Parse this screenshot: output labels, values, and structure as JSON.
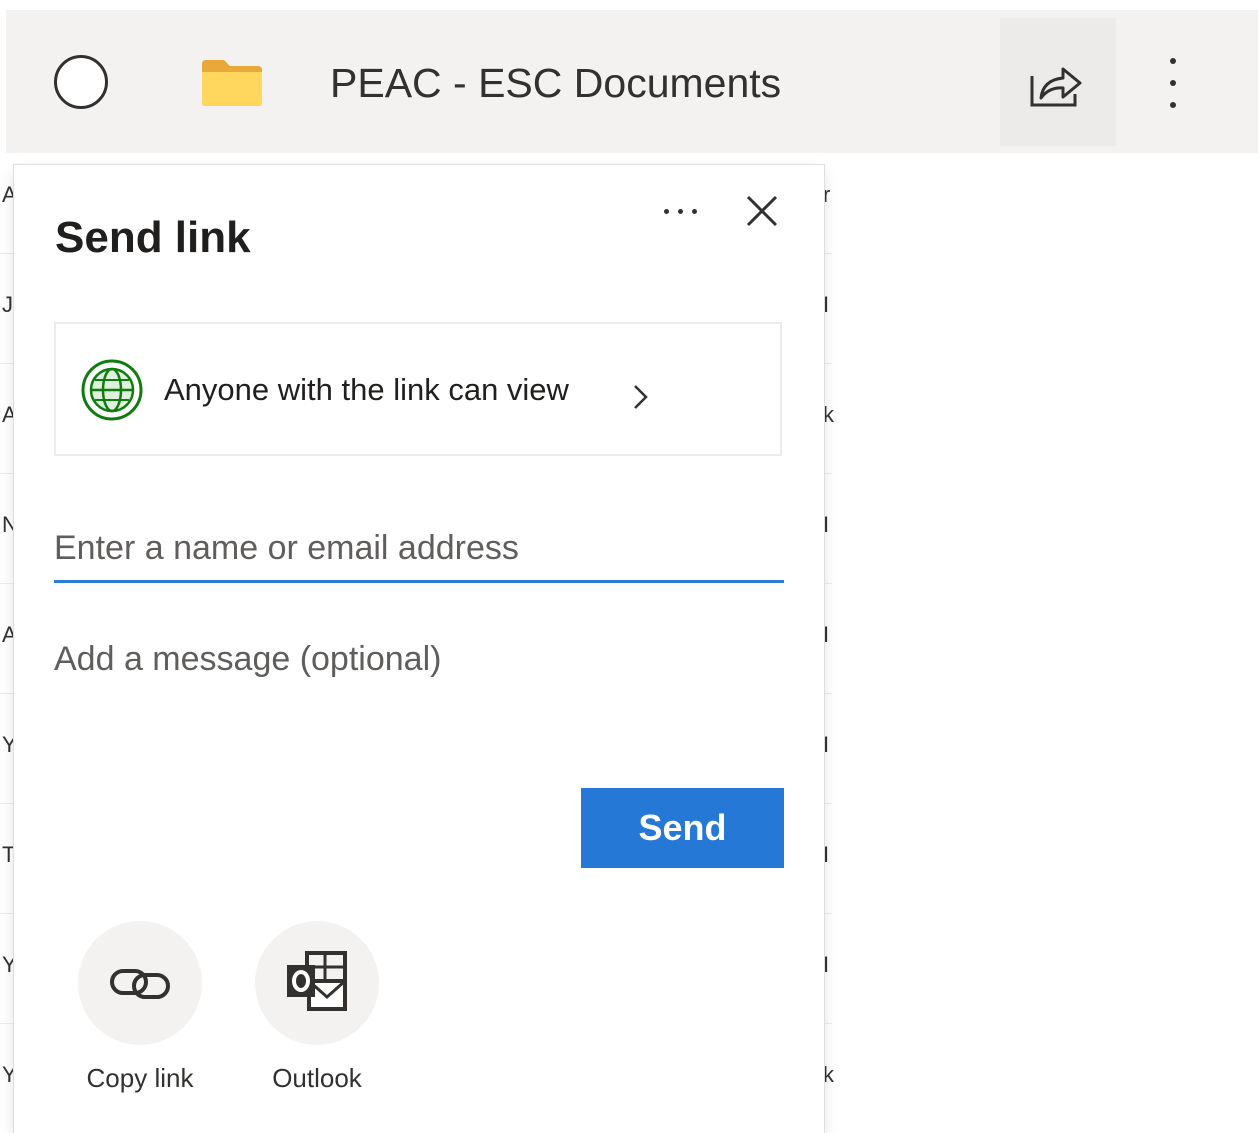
{
  "file_row": {
    "item_name": "PEAC - ESC Documents",
    "icons": {
      "select": "selection-circle-icon",
      "folder": "folder-icon",
      "share": "share-icon",
      "more": "more-vertical-icon"
    }
  },
  "share_panel": {
    "title": "Send link",
    "link_settings_label": "Anyone with the link can view",
    "recipient_placeholder": "Enter a name or email address",
    "message_placeholder": "Add a message (optional)",
    "send_label": "Send",
    "targets": [
      {
        "label": "Copy link",
        "icon": "copy-link-icon"
      },
      {
        "label": "Outlook",
        "icon": "outlook-icon"
      }
    ],
    "icons": {
      "more": "more-horizontal-icon",
      "close": "close-icon",
      "globe": "globe-icon",
      "chevron": "chevron-right-icon"
    }
  },
  "background_list": {
    "left_fragments": [
      "A",
      "J",
      "A",
      "N",
      "A",
      "Y",
      "T",
      "Y",
      "Y"
    ],
    "right_fragments": [
      "r",
      "I",
      "k",
      "I",
      "I",
      "I",
      "I",
      "I",
      "k"
    ]
  },
  "colors": {
    "accent": "#2678d6",
    "focus_underline": "#2b7bd9",
    "globe_green": "#107c10",
    "folder_yellow": "#ffd75e",
    "bar_background": "#f3f2f1"
  }
}
